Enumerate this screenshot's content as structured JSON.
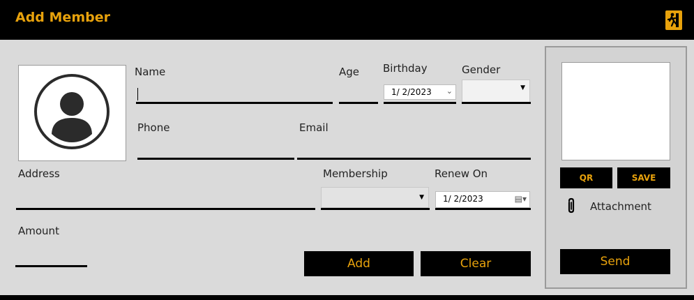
{
  "window": {
    "title": "Add Member",
    "exit_icon": "exit-running-man-icon"
  },
  "colors": {
    "accent": "#e8a20c",
    "background": "#dadada",
    "header": "#000000"
  },
  "form": {
    "name_label": "Name",
    "age_label": "Age",
    "birthday_label": "Birthday",
    "birthday_value": "1/ 2/2023",
    "gender_label": "Gender",
    "phone_label": "Phone",
    "email_label": "Email",
    "address_label": "Address",
    "membership_label": "Membership",
    "renew_label": "Renew On",
    "renew_value": "1/ 2/2023",
    "amount_label": "Amount",
    "add_label": "Add",
    "clear_label": "Clear"
  },
  "side": {
    "qr_label": "QR",
    "save_label": "SAVE",
    "attachment_label": "Attachment",
    "send_label": "Send"
  }
}
